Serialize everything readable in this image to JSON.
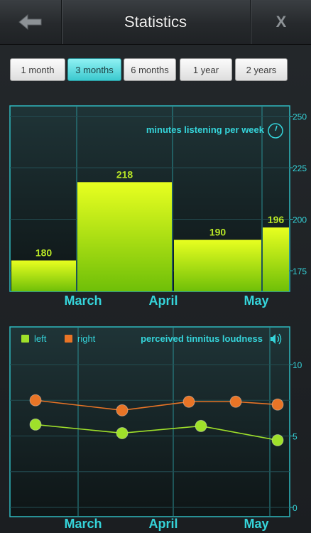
{
  "header": {
    "title": "Statistics",
    "back_icon": "back-arrow-icon",
    "close_label": "X"
  },
  "ranges": [
    {
      "label": "1 month",
      "active": false
    },
    {
      "label": "3 months",
      "active": true
    },
    {
      "label": "6 months",
      "active": false
    },
    {
      "label": "1 year",
      "active": false
    },
    {
      "label": "2 years",
      "active": false
    }
  ],
  "colors": {
    "accent": "#35d4da",
    "bar_top": "#e6ff1e",
    "bar_bottom": "#77c40a",
    "value_label": "#b8e626",
    "left_series": "#9fe02a",
    "right_series": "#e87426",
    "frame": "#2fb9bf"
  },
  "chart_data": [
    {
      "type": "bar",
      "title": "minutes listening per week",
      "icon": "stopwatch-icon",
      "categories": [
        "March",
        "April",
        "May"
      ],
      "bars": [
        {
          "value": 180
        },
        {
          "value": 218
        },
        {
          "value": 190
        },
        {
          "value": 196
        }
      ],
      "y_ticks": [
        250,
        225,
        200,
        175
      ],
      "ylim": [
        165,
        255
      ],
      "grid": true,
      "axis_side": "right"
    },
    {
      "type": "line",
      "title": "perceived tinnitus loudness",
      "icon": "speaker-icon",
      "categories": [
        "March",
        "April",
        "May"
      ],
      "series": [
        {
          "name": "left",
          "values": [
            5.8,
            5.2,
            5.7,
            4.7
          ]
        },
        {
          "name": "right",
          "values": [
            7.5,
            6.8,
            7.4,
            7.4,
            7.2
          ]
        }
      ],
      "y_ticks": [
        10,
        5,
        0
      ],
      "ylim": [
        0,
        10
      ],
      "grid": true,
      "legend_position": "top-left",
      "axis_side": "right"
    }
  ]
}
